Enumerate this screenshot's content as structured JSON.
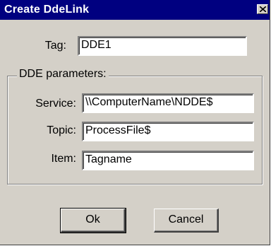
{
  "window": {
    "title": "Create DdeLink",
    "close_glyph": "close-icon"
  },
  "tag": {
    "label": "Tag:",
    "value": "DDE1"
  },
  "dde_parameters": {
    "legend": "DDE parameters:",
    "service": {
      "label": "Service:",
      "value": "\\\\ComputerName\\NDDE$"
    },
    "topic": {
      "label": "Topic:",
      "value": "ProcessFile$"
    },
    "item": {
      "label": "Item:",
      "value": "Tagname"
    }
  },
  "buttons": {
    "ok": "Ok",
    "cancel": "Cancel"
  },
  "colors": {
    "titlebar": "#000080",
    "face": "#d4d0c8"
  }
}
